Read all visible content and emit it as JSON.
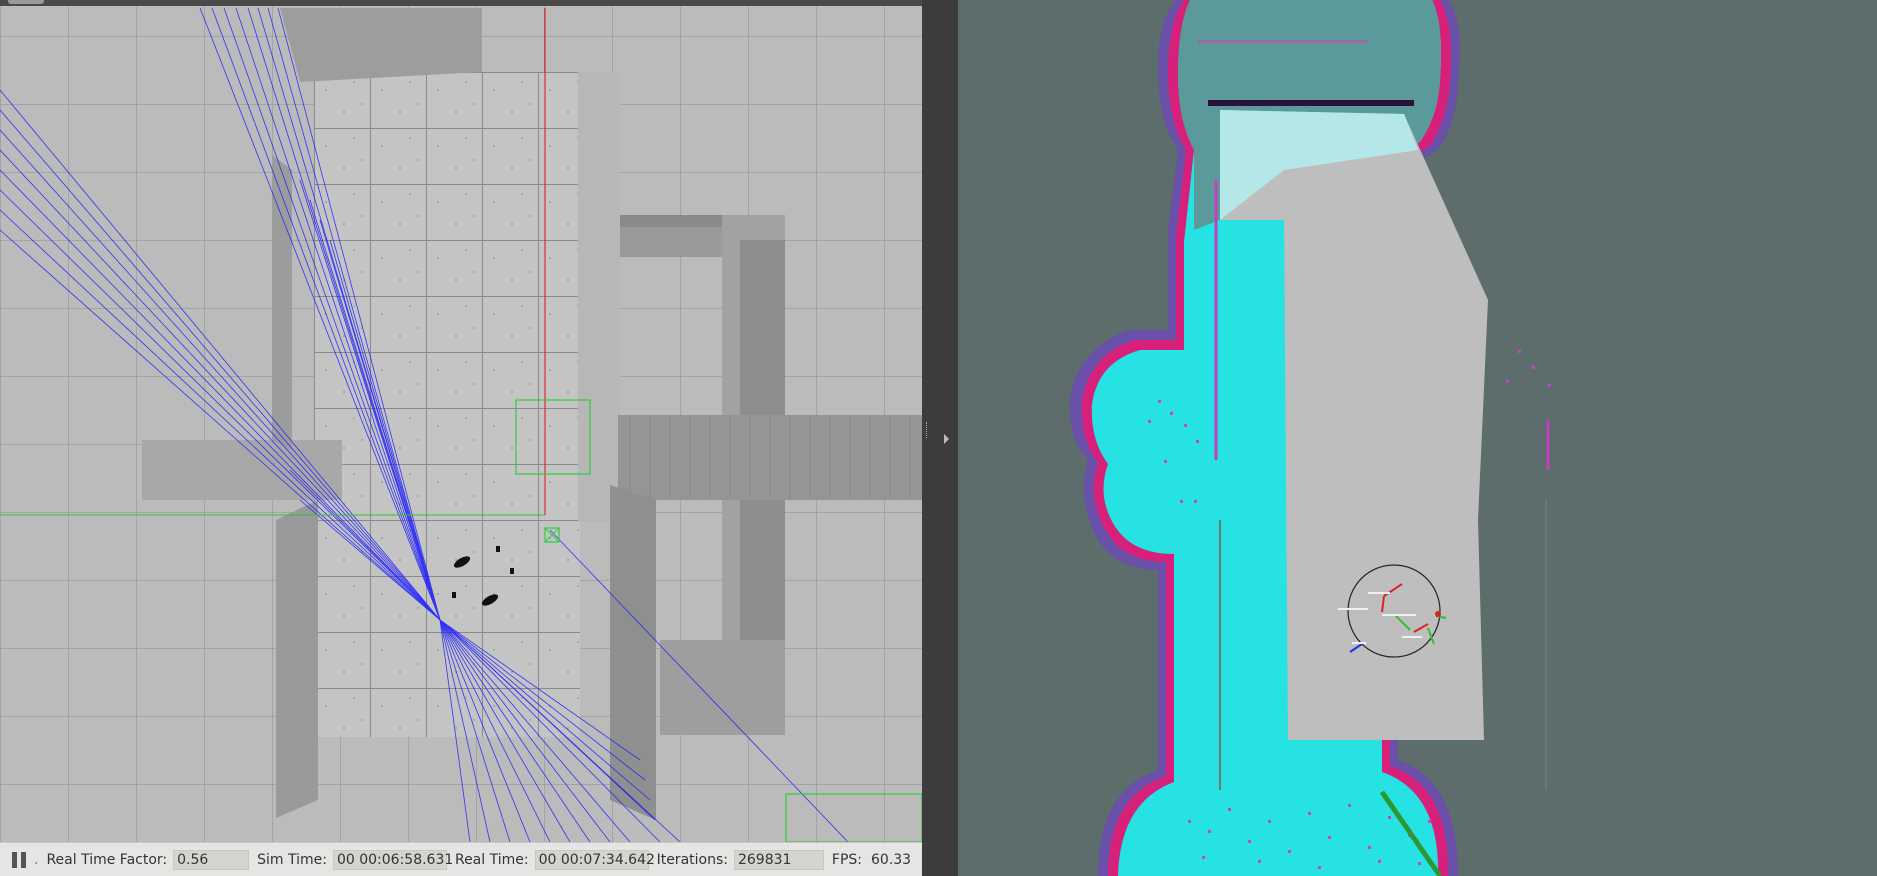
{
  "gazebo": {
    "statusbar": {
      "real_time_factor_label": "Real Time Factor:",
      "real_time_factor_value": "0.56",
      "sim_time_label": "Sim Time:",
      "sim_time_value": "00 00:06:58.631",
      "real_time_label": "Real Time:",
      "real_time_value": "00 00:07:34.642",
      "iterations_label": "Iterations:",
      "iterations_value": "269831",
      "fps_label": "FPS:",
      "fps_value": "60.33"
    }
  },
  "rviz": {},
  "colors": {
    "laser": "#1a1aff",
    "costmap_free": "#bdbdbd",
    "costmap_inflated": "#22e5e5",
    "costmap_lethal": "#d6207a",
    "background": "#5c6d6b"
  }
}
